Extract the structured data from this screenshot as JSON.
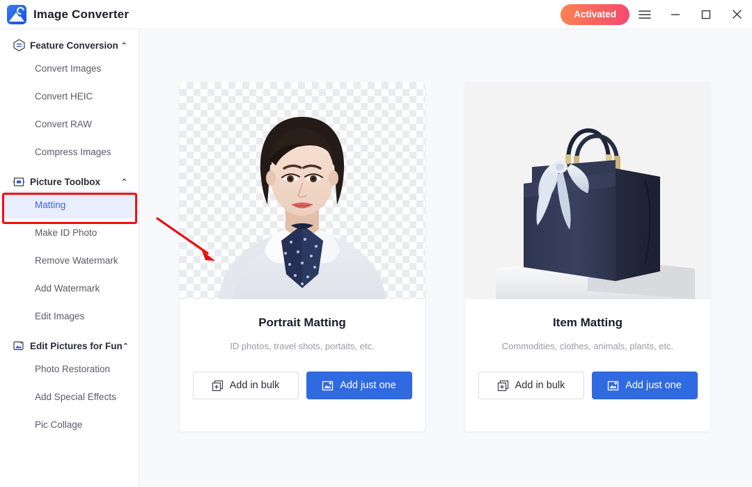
{
  "window": {
    "title": "Image Converter",
    "logo_icon": "image-converter-logo-icon",
    "activated_label": "Activated",
    "menu_icon": "hamburger-menu-icon",
    "minimize_icon": "minimize-icon",
    "maximize_icon": "maximize-icon",
    "close_icon": "close-icon",
    "accent_blue": "#2f6ae0",
    "activated_gradient_from": "#fb8453",
    "activated_gradient_to": "#f4486f"
  },
  "sidebar": {
    "groups": [
      {
        "label": "Feature Conversion",
        "icon": "hexagon-convert-icon",
        "caret": "⌃",
        "expanded": true,
        "items": [
          {
            "label": "Convert Images",
            "active": false
          },
          {
            "label": "Convert HEIC",
            "active": false
          },
          {
            "label": "Convert RAW",
            "active": false
          },
          {
            "label": "Compress Images",
            "active": false
          }
        ]
      },
      {
        "label": "Picture Toolbox",
        "icon": "toolbox-icon",
        "caret": "⌃",
        "expanded": true,
        "items": [
          {
            "label": "Matting",
            "active": true
          },
          {
            "label": "Make ID Photo",
            "active": false
          },
          {
            "label": "Remove Watermark",
            "active": false
          },
          {
            "label": "Add Watermark",
            "active": false
          },
          {
            "label": "Edit Images",
            "active": false
          }
        ]
      },
      {
        "label": "Edit Pictures for Fun",
        "icon": "magic-image-icon",
        "caret": "⌃",
        "expanded": true,
        "items": [
          {
            "label": "Photo Restoration",
            "active": false
          },
          {
            "label": "Add Special Effects",
            "active": false
          },
          {
            "label": "Pic Collage",
            "active": false
          }
        ]
      }
    ],
    "annotation": {
      "highlight_target": "Matting",
      "highlight_color": "#f50d0d"
    }
  },
  "main": {
    "cards": [
      {
        "title": "Portrait Matting",
        "subtitle": "ID photos, travel shots, portaits, etc.",
        "thumb": "portrait-transparent-checkerboard",
        "bulk_label": "Add in bulk",
        "bulk_icon": "add-stack-icon",
        "one_label": "Add just one",
        "one_icon": "add-image-icon"
      },
      {
        "title": "Item Matting",
        "subtitle": "Commodities, clothes, animals, plants, etc.",
        "thumb": "handbag-product-photo",
        "bulk_label": "Add in bulk",
        "bulk_icon": "add-stack-icon",
        "one_label": "Add just one",
        "one_icon": "add-image-icon"
      }
    ],
    "annotation_arrow": {
      "icon": "red-arrow-icon",
      "color": "#e81111",
      "points_to": "Portrait Matting card"
    }
  }
}
